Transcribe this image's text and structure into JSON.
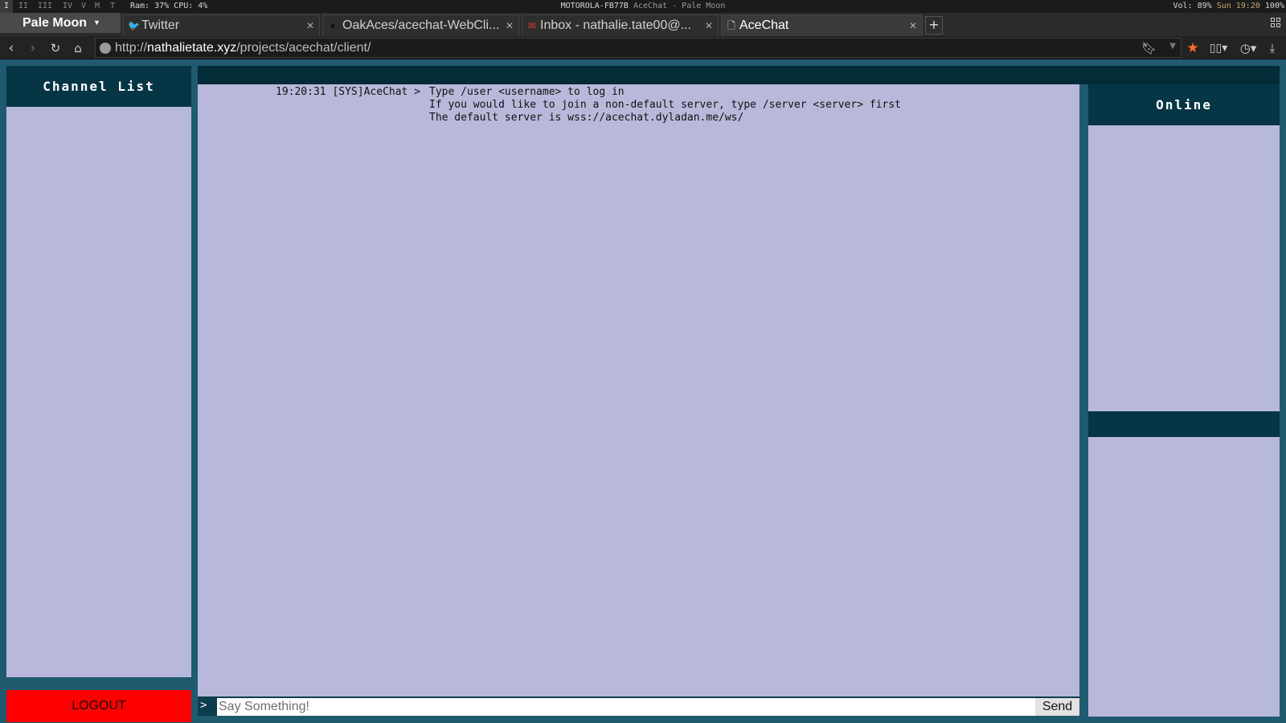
{
  "system_bar": {
    "workspaces": [
      "I",
      "II",
      "III",
      "IV",
      "V",
      "M",
      "T"
    ],
    "sysinfo": "Ram: 37% CPU: 4%",
    "network": "MOTOROLA-FB77B",
    "window_title": "AceChat - Pale Moon",
    "volume": "Vol: 89%",
    "clock": "Sun 19:20",
    "battery": "100%"
  },
  "browser": {
    "app_menu_label": "Pale Moon",
    "tabs": [
      {
        "label": "Twitter",
        "icon": "twitter-icon"
      },
      {
        "label": "OakAces/acechat-WebCli...",
        "icon": "github-icon"
      },
      {
        "label": "Inbox - nathalie.tate00@...",
        "icon": "gmail-icon"
      },
      {
        "label": "AceChat",
        "icon": "page-icon",
        "active": true
      }
    ],
    "url_prefix": "http://",
    "url_host": "nathalietate.xyz",
    "url_path": "/projects/acechat/client/"
  },
  "app": {
    "channel_list_title": "Channel List",
    "logout_label": "LOGOUT",
    "online_title": "Online",
    "input_prompt": ">",
    "input_placeholder": "Say Something!",
    "send_label": "Send",
    "messages": [
      {
        "timestamp": "19:20:31",
        "sender": "[SYS]AceChat",
        "lines": [
          "Type /user <username> to log in",
          "If you would like to join a non-default server, type /server <server> first",
          "The default server is wss://acechat.dyladan.me/ws/"
        ]
      }
    ]
  },
  "colors": {
    "page_bg": "#1f5a6e",
    "header_bg": "#063545",
    "panel_bg": "#b8b9da",
    "logout_bg": "#ff0000"
  }
}
